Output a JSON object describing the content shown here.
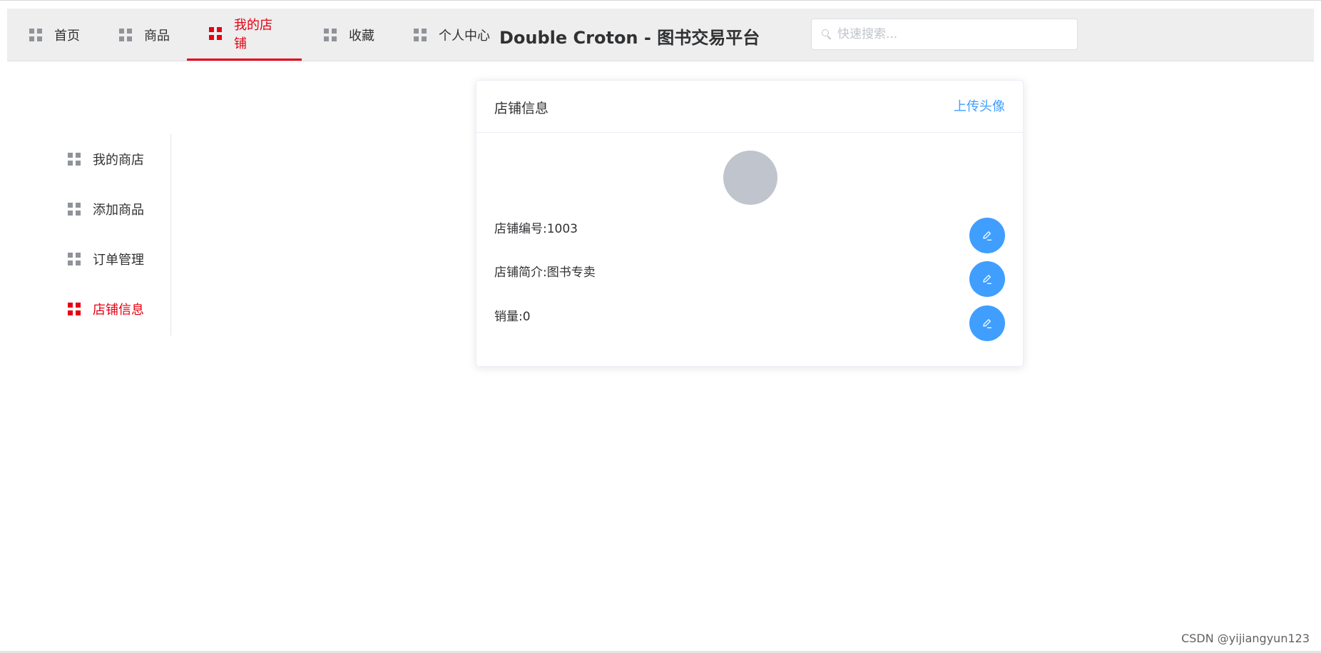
{
  "nav": {
    "items": [
      {
        "label": "首页",
        "icon": "grid-icon"
      },
      {
        "label": "商品",
        "icon": "grid-icon"
      },
      {
        "label": "我的店铺",
        "icon": "grid-icon",
        "active": true
      },
      {
        "label": "收藏",
        "icon": "grid-icon"
      },
      {
        "label": "个人中心",
        "icon": "grid-icon"
      }
    ],
    "active_color": "#e60012"
  },
  "site_title": "Double Croton - 图书交易平台",
  "search": {
    "placeholder": "快速搜索...",
    "value": ""
  },
  "sidebar": {
    "items": [
      {
        "label": "我的商店",
        "icon": "grid-icon"
      },
      {
        "label": "添加商品",
        "icon": "grid-icon"
      },
      {
        "label": "订单管理",
        "icon": "grid-icon"
      },
      {
        "label": "店铺信息",
        "icon": "grid-icon",
        "active": true
      }
    ]
  },
  "card": {
    "title": "店铺信息",
    "upload_label": "上传头像",
    "rows": [
      {
        "text": "店铺编号:1003",
        "action_icon": "edit-icon"
      },
      {
        "text": "店铺简介:图书专卖",
        "action_icon": "edit-icon"
      },
      {
        "text": "销量:0",
        "action_icon": "edit-icon"
      }
    ],
    "accent_color": "#409eff"
  },
  "watermark": "CSDN @yijiangyun123"
}
